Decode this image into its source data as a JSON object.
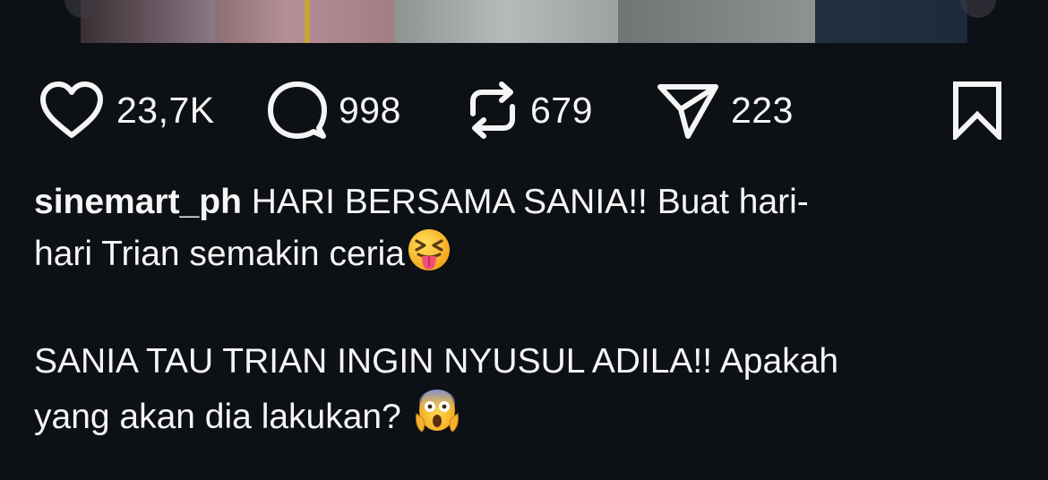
{
  "post": {
    "likes": "23,7K",
    "comments": "998",
    "reposts": "679",
    "shares": "223"
  },
  "caption": {
    "username": "sinemart_ph",
    "line1_text": "HARI BERSAMA SANIA!! Buat hari-",
    "line2_text": "hari Trian semakin ceria",
    "line2_emoji": "squinting-face-with-tongue",
    "line3_text": "SANIA TAU TRIAN INGIN NYUSUL ADILA!! Apakah",
    "line4_text": "yang akan dia lakukan? ",
    "line4_emoji": "face-screaming-in-fear"
  },
  "icons": {
    "like": "heart-outline-icon",
    "comment": "comment-bubble-icon",
    "repost": "repost-arrows-icon",
    "share": "paper-plane-icon",
    "bookmark": "bookmark-outline-icon"
  },
  "colors": {
    "background": "#0d1014",
    "text": "#f5f5f5"
  }
}
